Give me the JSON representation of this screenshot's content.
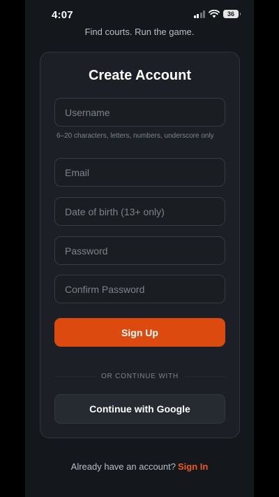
{
  "status_bar": {
    "time": "4:07",
    "battery": "36"
  },
  "tagline": "Find courts. Run the game.",
  "form": {
    "title": "Create Account",
    "username_placeholder": "Username",
    "username_value": "",
    "username_hint": "6–20 characters, letters, numbers, underscore only",
    "email_placeholder": "Email",
    "email_value": "",
    "dob_placeholder": "Date of birth (13+ only)",
    "dob_value": "",
    "password_placeholder": "Password",
    "password_value": "",
    "confirm_password_placeholder": "Confirm Password",
    "confirm_password_value": "",
    "signup_label": "Sign Up",
    "divider_label": "OR CONTINUE WITH",
    "google_label": "Continue with Google"
  },
  "footer": {
    "prompt": "Already have an account?",
    "signin_label": "Sign In"
  },
  "colors": {
    "accent": "#dd4a10",
    "link": "#ee5a1c",
    "background": "#14171c",
    "card": "#1c2026"
  }
}
